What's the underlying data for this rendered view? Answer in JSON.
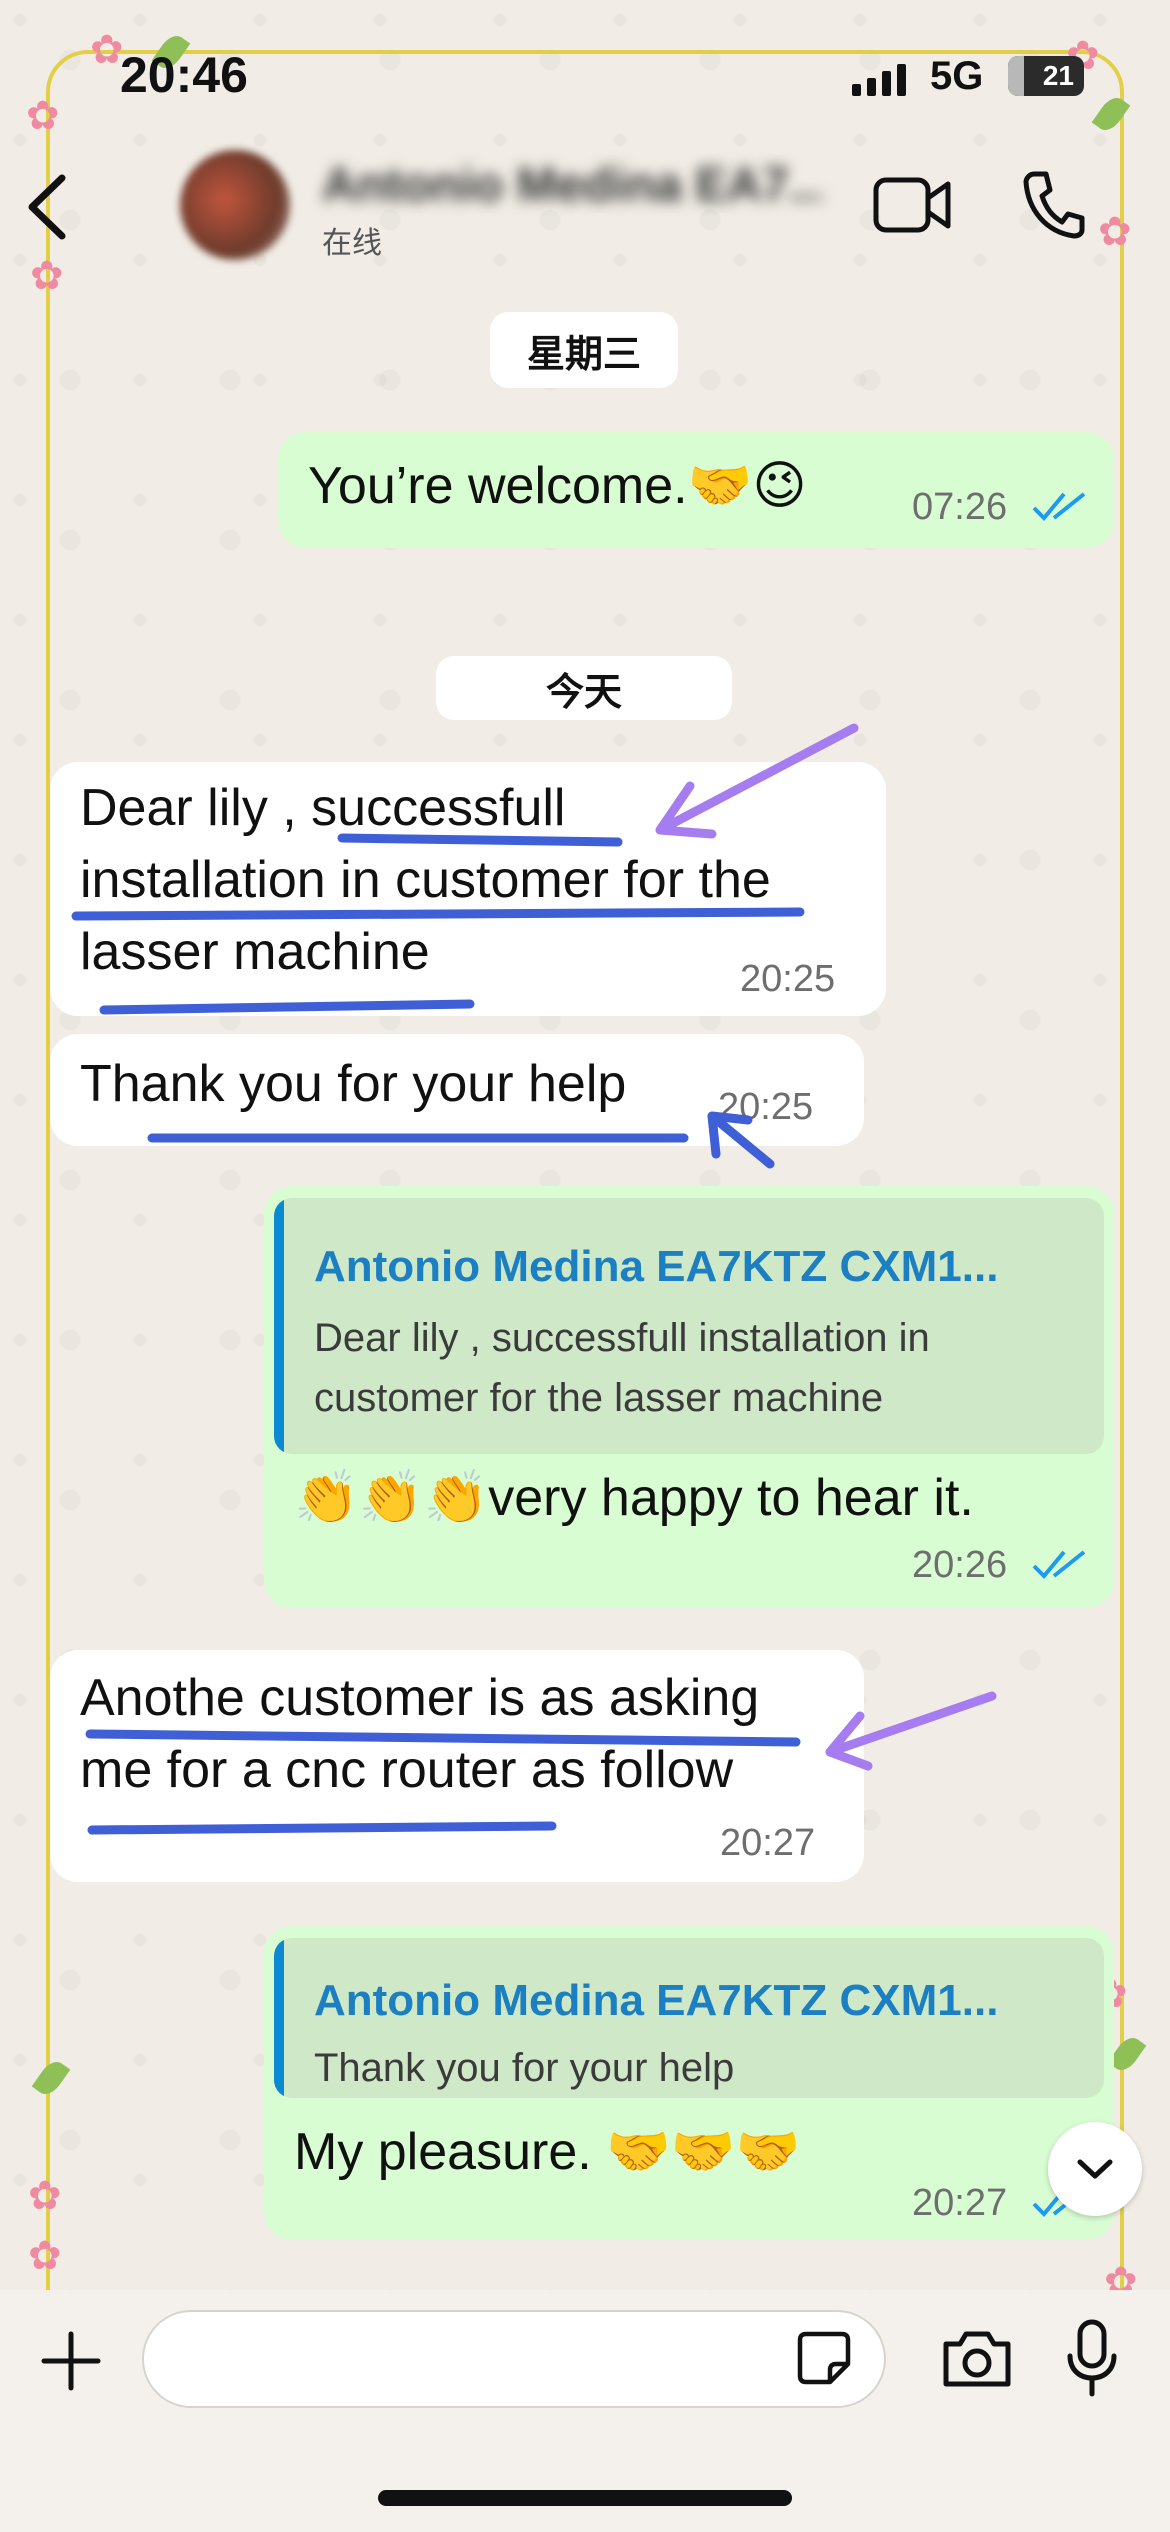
{
  "status_bar": {
    "time": "20:46",
    "network": "5G",
    "battery": "21",
    "battery_level": 0.21
  },
  "header": {
    "contact_name": "Antonio Medina EA7...",
    "status": "在线"
  },
  "date_separators": {
    "first": "星期三",
    "second": "今天"
  },
  "messages": [
    {
      "direction": "out",
      "text": "You’re welcome.",
      "emoji": "🤝😉",
      "time": "07:26",
      "ticks": "read"
    },
    {
      "direction": "in",
      "lines": [
        "Dear lily , successfull",
        "installation in customer for the",
        "lasser machine"
      ],
      "time": "20:25"
    },
    {
      "direction": "in",
      "text": "Thank you for your help",
      "time": "20:25"
    },
    {
      "direction": "out",
      "quote": {
        "author": "Antonio Medina EA7KTZ CXM1...",
        "lines": [
          "Dear lily , successfull installation in",
          "customer for the lasser machine"
        ]
      },
      "emoji": "👏👏👏",
      "text": "very happy to hear it.",
      "time": "20:26",
      "ticks": "read"
    },
    {
      "direction": "in",
      "lines": [
        "Anothe customer is as asking",
        "me for a cnc router as follow"
      ],
      "time": "20:27"
    },
    {
      "direction": "out",
      "quote": {
        "author": "Antonio Medina EA7KTZ CXM1...",
        "lines": [
          "Thank you for your help"
        ]
      },
      "text": "My pleasure. ",
      "emoji": "🤝🤝🤝",
      "time": "20:27",
      "ticks": "read"
    }
  ],
  "composer": {
    "placeholder": ""
  },
  "icons": [
    "back-icon",
    "video-call-icon",
    "phone-call-icon",
    "plus-icon",
    "sticker-icon",
    "camera-icon",
    "microphone-icon",
    "chevron-down-icon",
    "double-check-icon"
  ],
  "colors": {
    "outgoing_bubble": "#d9fdd3",
    "incoming_bubble": "#ffffff",
    "read_ticks": "#1d9bf0",
    "quote_author": "#1b7fc2",
    "annotation_blue": "#3f5fd6",
    "annotation_purple": "#a67df0",
    "frame": "#e2cf47"
  }
}
